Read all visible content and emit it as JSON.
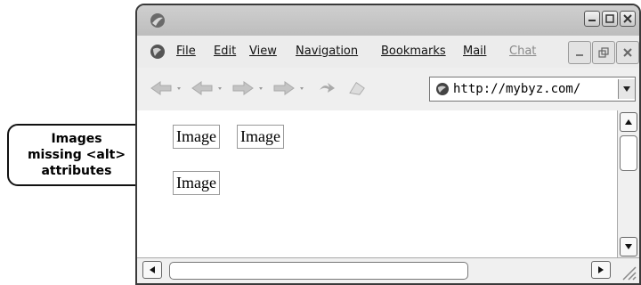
{
  "menu": {
    "file": "File",
    "edit": "Edit",
    "view": "View",
    "navigation": "Navigation",
    "bookmarks": "Bookmarks",
    "mail": "Mail",
    "chat": "Chat"
  },
  "address": {
    "url": "http://mybyz.com/"
  },
  "content": {
    "images": [
      "Image",
      "Image",
      "Image"
    ]
  },
  "callout": {
    "line1": "Images",
    "line2": "missing <alt>",
    "line3": "attributes"
  }
}
